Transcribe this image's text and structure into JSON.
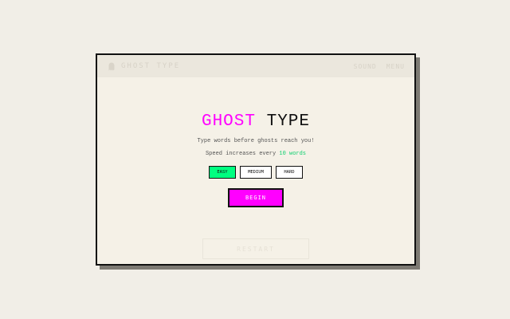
{
  "header": {
    "brand": "GHOST TYPE",
    "nav": [
      "SOUND",
      "MENU"
    ]
  },
  "main": {
    "title_part1": "GHOST",
    "title_part2": "TYPE",
    "subtitle": "Type words before ghosts reach you!",
    "speed_prefix": "Speed increases every ",
    "speed_highlight": "10 words",
    "difficulty": {
      "easy": "EASY",
      "medium": "MEDIUM",
      "hard": "HARD",
      "selected": "EASY"
    },
    "begin_label": "BEGIN",
    "faded_button_label": "RESTART"
  },
  "colors": {
    "accent": "#ff00ff",
    "easy_selected": "#00ff80",
    "highlight_text": "#0fcf6f",
    "frame": "#111111",
    "background": "#f5f1e7"
  },
  "icons": {
    "logo": "ghost-icon"
  }
}
